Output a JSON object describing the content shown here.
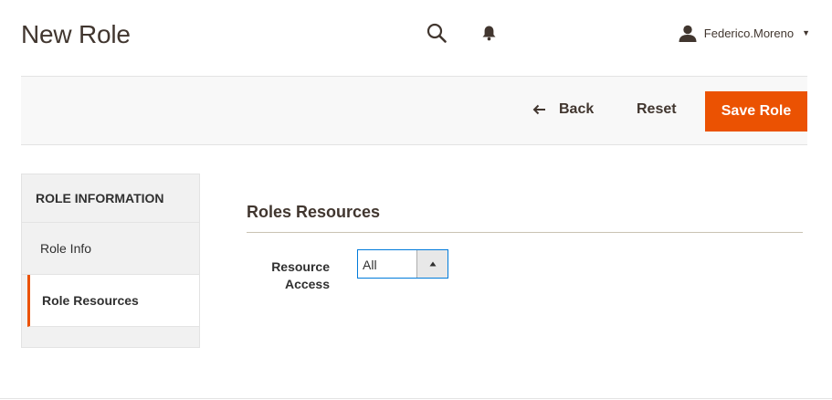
{
  "page": {
    "title": "New Role"
  },
  "header": {
    "search_icon": "search-icon",
    "notifications_icon": "bell-icon",
    "user": {
      "name": "Federico.Moreno",
      "icon": "user-icon"
    }
  },
  "action_bar": {
    "back_label": "Back",
    "reset_label": "Reset",
    "save_label": "Save Role",
    "save_color": "#eb5202"
  },
  "sidebar": {
    "title": "ROLE INFORMATION",
    "items": [
      {
        "label": "Role Info",
        "active": false
      },
      {
        "label": "Role Resources",
        "active": true
      }
    ]
  },
  "main": {
    "section_title": "Roles Resources",
    "resource_access": {
      "label_line1": "Resource",
      "label_line2": "Access",
      "value": "All"
    }
  }
}
